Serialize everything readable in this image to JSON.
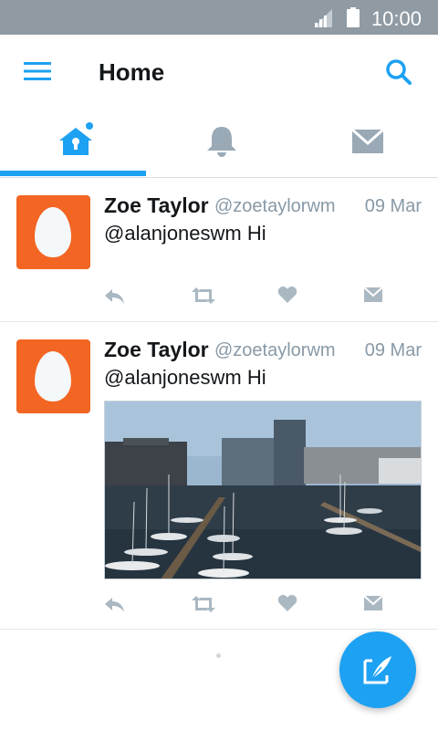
{
  "status_bar": {
    "time": "10:00"
  },
  "app_bar": {
    "title": "Home"
  },
  "tabs": [
    {
      "id": "home",
      "icon": "home-icon",
      "active": true,
      "has_notification_dot": true
    },
    {
      "id": "notifications",
      "icon": "bell-icon",
      "active": false
    },
    {
      "id": "messages",
      "icon": "envelope-icon",
      "active": false
    }
  ],
  "tweets": [
    {
      "name": "Zoe Taylor",
      "handle": "@zoetaylorwm",
      "date": "09 Mar",
      "text": "@alanjoneswm Hi",
      "avatar_color": "#f26522",
      "has_media": false
    },
    {
      "name": "Zoe Taylor",
      "handle": "@zoetaylorwm",
      "date": "09 Mar",
      "text": "@alanjoneswm Hi",
      "avatar_color": "#f26522",
      "has_media": true,
      "media_description_icon": "harbor-photo"
    }
  ],
  "colors": {
    "accent": "#1da1f2",
    "status_bar": "#8f9aa3",
    "secondary_text": "#8899a6",
    "action_icon": "#aab8c2"
  },
  "fab": {
    "icon": "compose-tweet-icon"
  }
}
